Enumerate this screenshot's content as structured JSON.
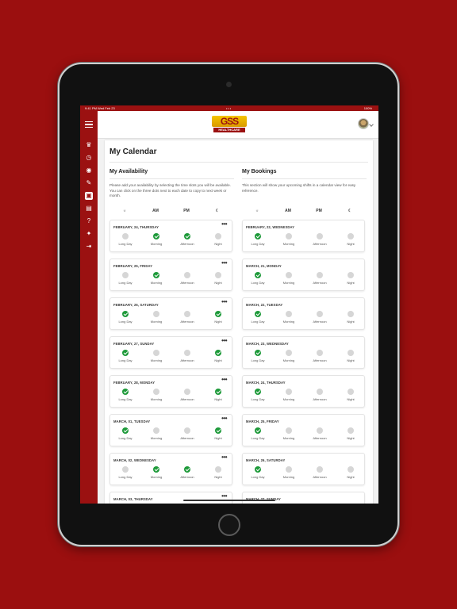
{
  "statusbar": {
    "left": "9:41 PM Wed Feb 23",
    "dots": "•••",
    "right": "100%"
  },
  "logo": {
    "letters": "GSS",
    "sub": "HEALTHCARE"
  },
  "page": {
    "title": "My Calendar"
  },
  "availability": {
    "title": "My Availability",
    "description": "Please add your availability by selecting the time slots you will be available. You can click on the three dots next to each date to copy to next week or month.",
    "headers": [
      "AM",
      "PM"
    ],
    "header_icons": [
      "sun-icon",
      "moon-icon"
    ],
    "slot_labels": [
      "Long Day",
      "Morning",
      "Afternoon",
      "Night"
    ],
    "more_label": "•••",
    "days": [
      {
        "date": "FEBRUARY, 24, THURSDAY",
        "slots": [
          false,
          true,
          true,
          false
        ]
      },
      {
        "date": "FEBRUARY, 25, FRIDAY",
        "slots": [
          false,
          true,
          false,
          false
        ]
      },
      {
        "date": "FEBRUARY, 26, SATURDAY",
        "slots": [
          true,
          false,
          false,
          true
        ]
      },
      {
        "date": "FEBRUARY, 27, SUNDAY",
        "slots": [
          true,
          false,
          false,
          true
        ]
      },
      {
        "date": "FEBRUARY, 28, MONDAY",
        "slots": [
          true,
          false,
          false,
          true
        ]
      },
      {
        "date": "MARCH, 01, TUESDAY",
        "slots": [
          true,
          false,
          false,
          true
        ]
      },
      {
        "date": "MARCH, 02, WEDNESDAY",
        "slots": [
          false,
          true,
          true,
          false
        ]
      },
      {
        "date": "MARCH, 03, THURSDAY",
        "slots": [
          false,
          false,
          false,
          false
        ]
      }
    ]
  },
  "bookings": {
    "title": "My Bookings",
    "description": "This section will show your upcoming shifts in a calendar view for easy reference.",
    "headers": [
      "AM",
      "PM"
    ],
    "slot_labels": [
      "Long Day",
      "Morning",
      "Afternoon",
      "Night"
    ],
    "days": [
      {
        "date": "FEBRUARY, 22, WEDNESDAY",
        "slots": [
          true,
          false,
          false,
          false
        ]
      },
      {
        "date": "MARCH, 21, MONDAY",
        "slots": [
          true,
          false,
          false,
          false
        ]
      },
      {
        "date": "MARCH, 22, TUESDAY",
        "slots": [
          true,
          false,
          false,
          false
        ]
      },
      {
        "date": "MARCH, 23, WEDNESDAY",
        "slots": [
          true,
          false,
          false,
          false
        ]
      },
      {
        "date": "MARCH, 24, THURSDAY",
        "slots": [
          true,
          false,
          false,
          false
        ]
      },
      {
        "date": "MARCH, 25, FRIDAY",
        "slots": [
          true,
          false,
          false,
          false
        ]
      },
      {
        "date": "MARCH, 26, SATURDAY",
        "slots": [
          true,
          false,
          false,
          false
        ]
      },
      {
        "date": "MARCH, 27, SUNDAY",
        "slots": [
          false,
          false,
          false,
          false
        ]
      }
    ]
  },
  "sidebar": {
    "icons": [
      "crown-icon",
      "clock-icon",
      "target-icon",
      "edit-icon",
      "calendar-icon",
      "document-icon",
      "help-icon",
      "wrench-icon",
      "logout-icon"
    ],
    "glyphs": [
      "♛",
      "◷",
      "◉",
      "✎",
      "▣",
      "▤",
      "?",
      "✦",
      "⇥"
    ],
    "active_index": 4
  },
  "colors": {
    "brand": "#9b1111",
    "check": "#1e9a3a",
    "inactive": "#d6d6d6"
  }
}
